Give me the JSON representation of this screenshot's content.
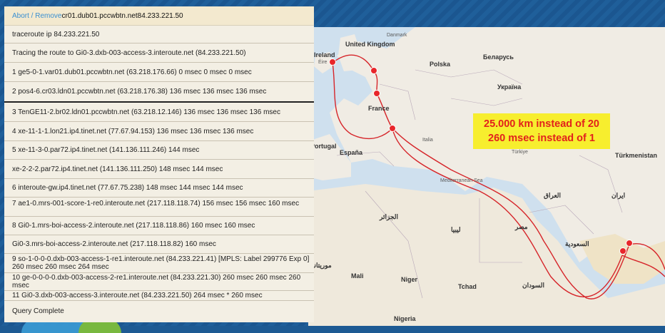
{
  "header": {
    "action_link": "Abort / Remove",
    "router_name": "cr01.dub01.pccwbtn.net84.233.221.50"
  },
  "rows": [
    "traceroute ip 84.233.221.50",
    "Tracing the route to Gi0-3.dxb-003-access-3.interoute.net (84.233.221.50)",
    "1 ge5-0-1.var01.dub01.pccwbtn.net (63.218.176.66) 0 msec 0 msec 0 msec",
    "2 pos4-6.cr03.ldn01.pccwbtn.net (63.218.176.38) 136 msec 136 msec 136 msec",
    "3 TenGE11-2.br02.ldn01.pccwbtn.net (63.218.12.146) 136 msec 136 msec 136 msec",
    "4 xe-11-1-1.lon21.ip4.tinet.net (77.67.94.153) 136 msec 136 msec 136 msec",
    "5 xe-11-3-0.par72.ip4.tinet.net (141.136.111.246) 144 msec",
    "xe-2-2-2.par72.ip4.tinet.net (141.136.111.250) 148 msec 144 msec",
    "6 interoute-gw.ip4.tinet.net (77.67.75.238) 148 msec 144 msec 144 msec",
    "7 ae1-0.mrs-001-score-1-re0.interoute.net (217.118.118.74) 156 msec 156 msec 160 msec",
    "8 Gi0-1.mrs-boi-access-2.interoute.net (217.118.118.86) 160 msec 160 msec",
    "Gi0-3.mrs-boi-access-2.interoute.net (217.118.118.82) 160 msec",
    "9 so-1-0-0-0.dxb-003-access-1-re1.interoute.net (84.233.221.41) [MPLS: Label 299776 Exp 0] 260 msec 260 msec 264 msec",
    "10 ge-0-0-0-0.dxb-003-access-2-re1.interoute.net (84.233.221.30) 260 msec 260 msec 260 msec",
    "11 Gi0-3.dxb-003-access-3.interoute.net (84.233.221.50) 264 msec * 260 msec",
    "Query Complete"
  ],
  "callout": {
    "line1": "25.000 km instead of 20",
    "line2": "260 msec instead of 1"
  },
  "map_labels": {
    "united_kingdom": "United Kingdom",
    "ireland": "Ireland",
    "eire": "Éire",
    "denmark": "Danmark",
    "polska": "Polska",
    "belarus": "Беларусь",
    "ukraine": "Україна",
    "france": "France",
    "portugal": "Portugal",
    "espana": "España",
    "italia": "Italia",
    "turkiye": "Türkiye",
    "turkmenistan": "Türkmenistan",
    "iraq": "العراق",
    "iran": "ایران",
    "saudi": "السعودية",
    "libya": "ليبيا",
    "egypt": "مصر",
    "algeria": "الجزائر",
    "mauritania": "موريتانيا",
    "mali": "Mali",
    "niger": "Niger",
    "tchad": "Tchad",
    "sudan": "السودان",
    "nigeria": "Nigeria",
    "mediterranean": "Mediterranean Sea"
  }
}
